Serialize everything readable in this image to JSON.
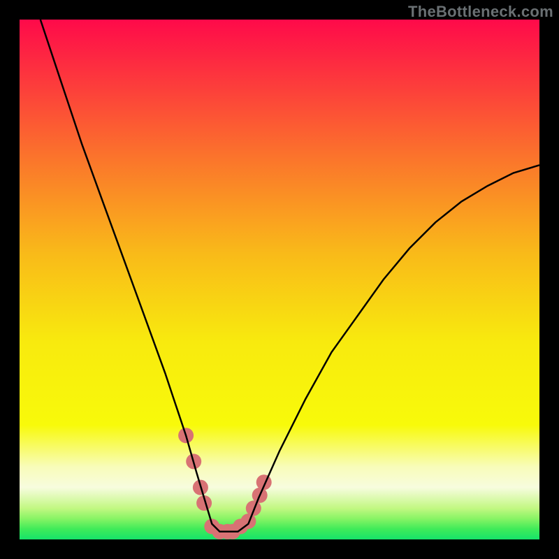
{
  "watermark": "TheBottleneck.com",
  "chart_data": {
    "type": "line",
    "title": "",
    "xlabel": "",
    "ylabel": "",
    "xlim": [
      0,
      100
    ],
    "ylim": [
      0,
      100
    ],
    "series": [
      {
        "name": "bottleneck-curve",
        "x": [
          4,
          8,
          12,
          16,
          20,
          24,
          28,
          30,
          32,
          34,
          35.5,
          37,
          38.5,
          40,
          42,
          44,
          46,
          50,
          55,
          60,
          65,
          70,
          75,
          80,
          85,
          90,
          95,
          100
        ],
        "y": [
          100,
          88,
          76,
          65,
          54,
          43,
          32,
          26,
          20,
          13,
          8,
          3,
          1.5,
          1.5,
          1.5,
          3,
          8,
          17,
          27,
          36,
          43,
          50,
          56,
          61,
          65,
          68,
          70.5,
          72
        ],
        "color": "#000000"
      }
    ],
    "annotations": {
      "markers": [
        {
          "x": 32.0,
          "y": 20.0
        },
        {
          "x": 33.5,
          "y": 15.0
        },
        {
          "x": 34.8,
          "y": 10.0
        },
        {
          "x": 35.5,
          "y": 7.0
        },
        {
          "x": 37.0,
          "y": 2.5
        },
        {
          "x": 38.5,
          "y": 1.5
        },
        {
          "x": 40.0,
          "y": 1.5
        },
        {
          "x": 41.0,
          "y": 1.5
        },
        {
          "x": 42.5,
          "y": 2.5
        },
        {
          "x": 44.0,
          "y": 3.5
        },
        {
          "x": 45.0,
          "y": 6.0
        },
        {
          "x": 46.2,
          "y": 8.5
        },
        {
          "x": 47.0,
          "y": 11.0
        }
      ],
      "marker_color": "#D87274"
    },
    "gradient_bands": [
      {
        "y": 100,
        "color": "#FE0A4A"
      },
      {
        "y": 74,
        "color": "#FB722C"
      },
      {
        "y": 55,
        "color": "#F9BA19"
      },
      {
        "y": 38,
        "color": "#F8EA0E"
      },
      {
        "y": 22,
        "color": "#F8FA0A"
      },
      {
        "y": 14,
        "color": "#F8FCB9"
      },
      {
        "y": 10,
        "color": "#F7FCDE"
      },
      {
        "y": 6,
        "color": "#C2F882"
      },
      {
        "y": 4,
        "color": "#88F465"
      },
      {
        "y": 2,
        "color": "#3FEB59"
      },
      {
        "y": 0,
        "color": "#16E36A"
      }
    ]
  }
}
